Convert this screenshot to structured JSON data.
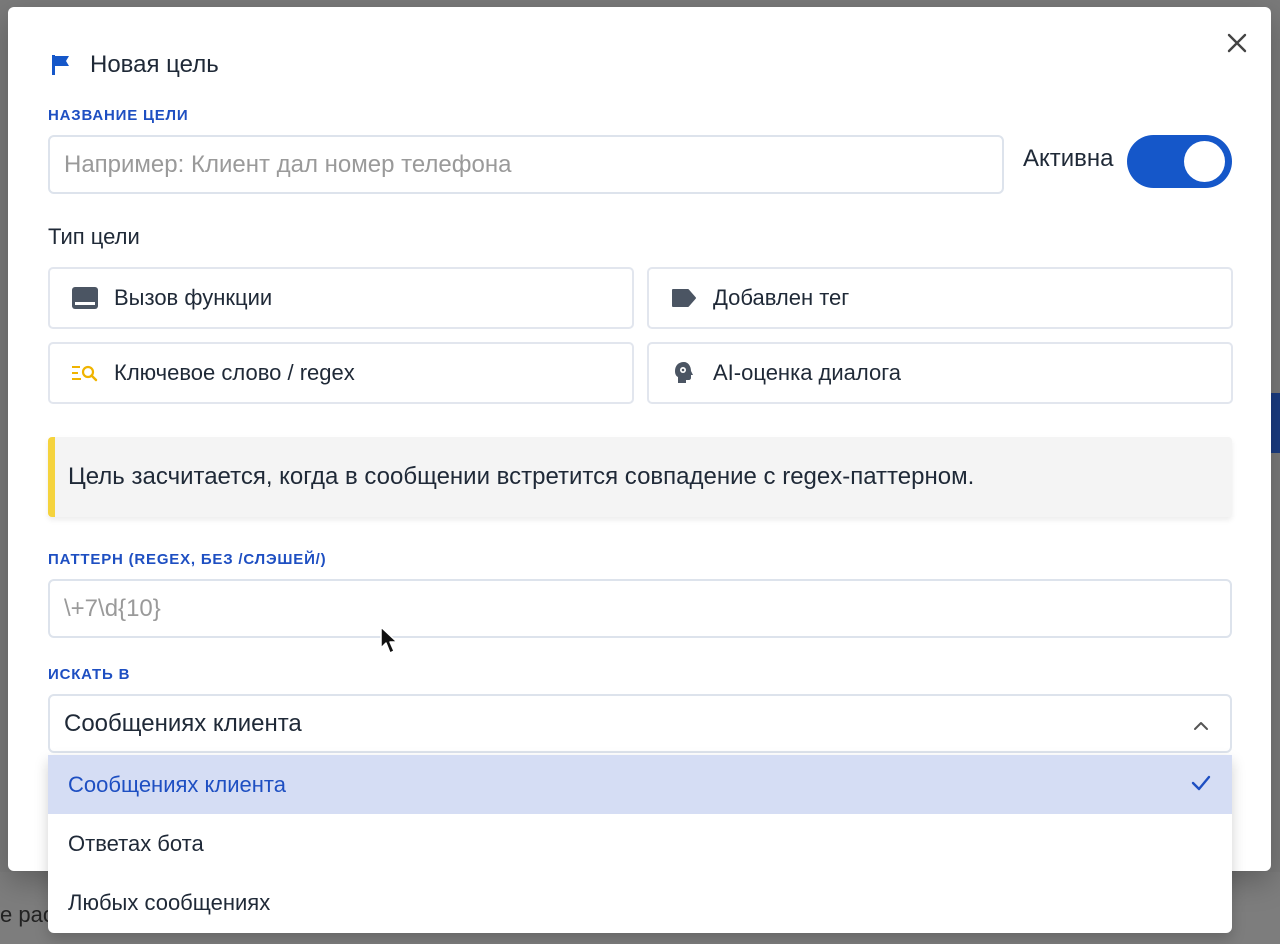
{
  "modal": {
    "title": "Новая цель",
    "goal_name": {
      "label": "НАЗВАНИЕ ЦЕЛИ",
      "placeholder": "Например: Клиент дал номер телефона"
    },
    "active": {
      "label": "Активна",
      "on": true
    },
    "goal_type": {
      "label": "Тип цели",
      "options": [
        {
          "label": "Вызов функции",
          "icon": "function-icon"
        },
        {
          "label": "Добавлен тег",
          "icon": "tag-icon"
        },
        {
          "label": "Ключевое слово / regex",
          "icon": "keyword-search-icon",
          "selected": true
        },
        {
          "label": "AI-оценка диалога",
          "icon": "ai-head-icon"
        }
      ]
    },
    "info_text": "Цель засчитается, когда в сообщении встретится совпадение с regex-паттерном.",
    "pattern": {
      "label": "ПАТТЕРН (REGEX, БЕЗ /СЛЭШЕЙ/)",
      "placeholder": "\\+7\\d{10}"
    },
    "search_in": {
      "label": "ИСКАТЬ В",
      "value": "Сообщениях клиента",
      "options": [
        {
          "label": "Сообщениях клиента",
          "selected": true
        },
        {
          "label": "Ответах бота",
          "selected": false
        },
        {
          "label": "Любых сообщениях",
          "selected": false
        }
      ]
    }
  },
  "background": {
    "bottom_text": "е раст"
  },
  "colors": {
    "accent": "#1557c9",
    "label_blue": "#1e4fc2",
    "info_border": "#f5d33d",
    "selected_option_bg": "#d5ddf4"
  }
}
